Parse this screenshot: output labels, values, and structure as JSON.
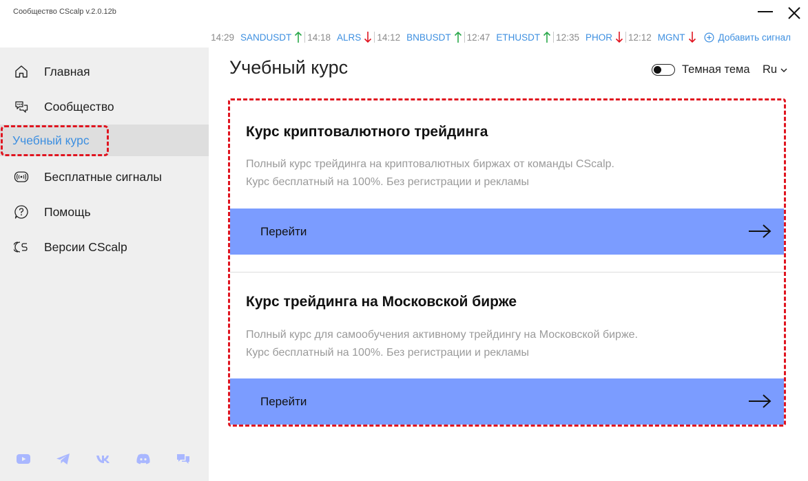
{
  "app": {
    "title": "Сообщество CScalp v.2.0.12b"
  },
  "window_controls": {
    "minimize_icon": "minimize-icon",
    "close_icon": "close-icon"
  },
  "ticker": {
    "items": [
      {
        "time": "14:29",
        "symbol": "SANDUSDT",
        "direction": "up"
      },
      {
        "time": "14:18",
        "symbol": "ALRS",
        "direction": "down"
      },
      {
        "time": "14:12",
        "symbol": "BNBUSDT",
        "direction": "up"
      },
      {
        "time": "12:47",
        "symbol": "ETHUSDT",
        "direction": "up"
      },
      {
        "time": "12:35",
        "symbol": "PHOR",
        "direction": "down"
      },
      {
        "time": "12:12",
        "symbol": "MGNT",
        "direction": "down"
      }
    ],
    "add_signal_label": "Добавить сигнал"
  },
  "colors": {
    "accent": "#3d8fe0",
    "up": "#2aa84a",
    "down": "#e0141f",
    "button": "#7b9cff",
    "highlight": "#e0141f"
  },
  "sidebar": {
    "items": [
      {
        "label": "Главная",
        "icon": "home-icon",
        "active": false
      },
      {
        "label": "Сообщество",
        "icon": "community-icon",
        "active": false
      },
      {
        "label": "Учебный курс",
        "icon": "",
        "active": true
      },
      {
        "label": "Бесплатные сигналы",
        "icon": "signals-icon",
        "active": false
      },
      {
        "label": "Помощь",
        "icon": "help-icon",
        "active": false
      },
      {
        "label": "Версии CScalp",
        "icon": "versions-icon",
        "active": false
      }
    ],
    "socials": [
      "youtube-icon",
      "telegram-icon",
      "vk-icon",
      "discord-icon",
      "chat-icon"
    ]
  },
  "main": {
    "title": "Учебный курс",
    "theme_toggle_label": "Темная тема",
    "theme_dark_enabled": false,
    "language": "Ru",
    "cards": [
      {
        "title": "Курс криптовалютного трейдинга",
        "desc_line1": "Полный курс трейдинга на криптовалютных биржах от команды CScalp.",
        "desc_line2": "Курс бесплатный на 100%. Без регистрации и рекламы",
        "button_label": "Перейти"
      },
      {
        "title": "Курс трейдинга на Московской бирже",
        "desc_line1": "Полный курс для самообучения активному трейдингу на Московской бирже.",
        "desc_line2": "Курс бесплатный на 100%. Без регистрации и рекламы",
        "button_label": "Перейти"
      }
    ]
  }
}
